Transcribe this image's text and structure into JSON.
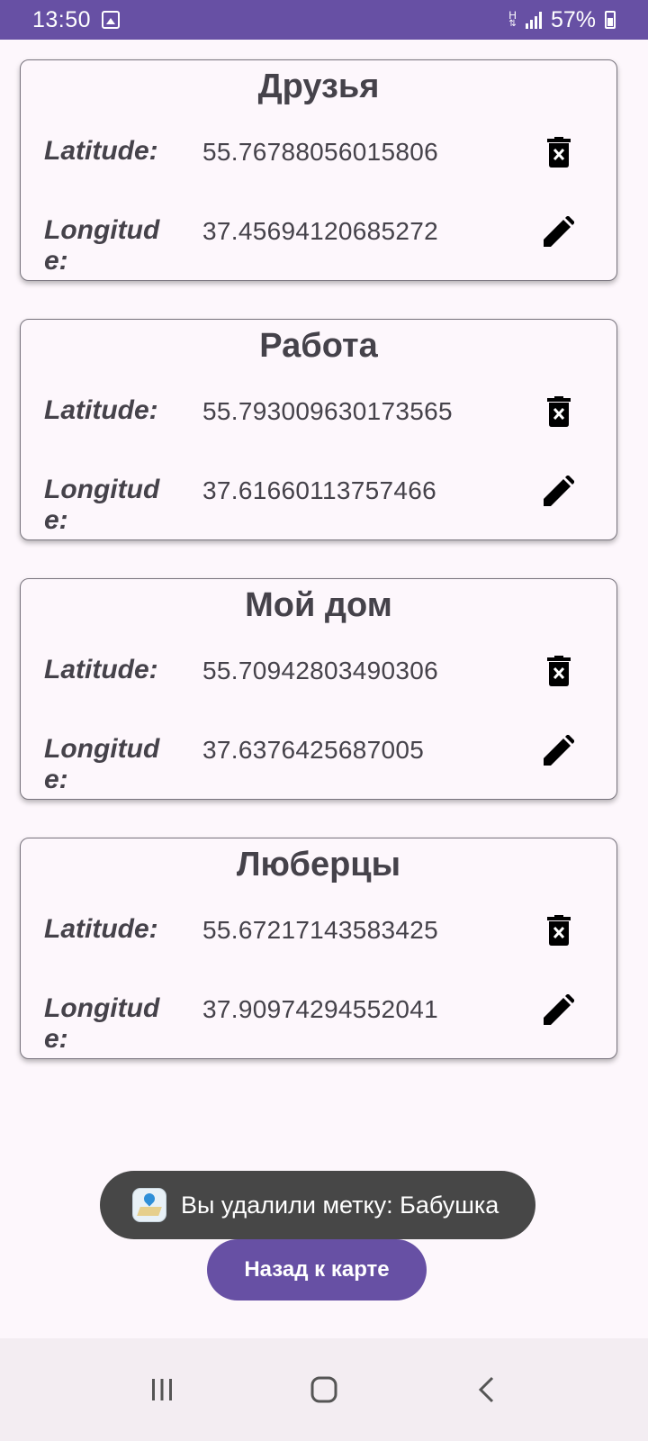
{
  "status_bar": {
    "time": "13:50",
    "network": "H",
    "battery": "57%",
    "background_color": "#6750a4"
  },
  "places": [
    {
      "name": "Друзья",
      "latitude_label": "Latitude:",
      "latitude": "55.76788056015806",
      "longitude_label": "Longitude:",
      "longitude": "37.45694120685272"
    },
    {
      "name": "Работа",
      "latitude_label": "Latitude:",
      "latitude": "55.793009630173565",
      "longitude_label": "Longitude:",
      "longitude": "37.61660113757466"
    },
    {
      "name": "Мой дом",
      "latitude_label": "Latitude:",
      "latitude": "55.70942803490306",
      "longitude_label": "Longitude:",
      "longitude": "37.6376425687005"
    },
    {
      "name": "Люберцы",
      "latitude_label": "Latitude:",
      "latitude": "55.67217143583425",
      "longitude_label": "Longitude:",
      "longitude": "37.90974294552041"
    }
  ],
  "icons": {
    "delete": "delete-icon",
    "edit": "edit-icon"
  },
  "toast": {
    "text": "Вы удалили метку: Бабушка"
  },
  "back_button": {
    "label": "Назад к карте",
    "color": "#6750a4"
  },
  "nav_bar": {
    "recents": "recents-icon",
    "home": "home-icon",
    "back": "back-icon"
  }
}
